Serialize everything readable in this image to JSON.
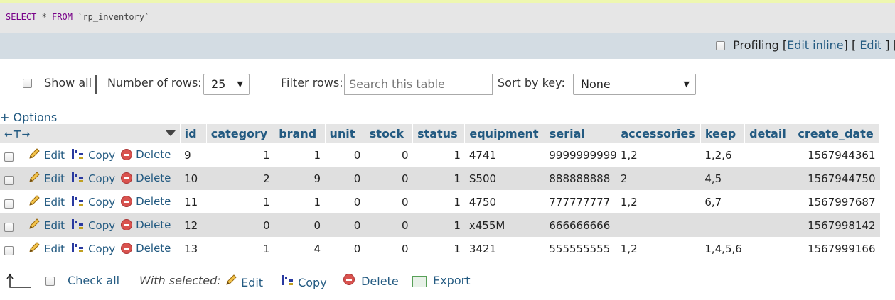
{
  "sql": {
    "kw_select": "SELECT",
    "rest_star": " * ",
    "kw_from": "FROM",
    "table": " `rp_inventory`"
  },
  "profiling": {
    "label": "Profiling",
    "edit_inline": "Edit inline",
    "edit": "Edit",
    "explain_cut": "E",
    "open": "[",
    "close": "]"
  },
  "nav": {
    "show_all": "Show all",
    "num_rows_label": "Number of rows:",
    "num_rows_value": "25",
    "filter_label": "Filter rows:",
    "filter_placeholder": "Search this table",
    "sort_label": "Sort by key:",
    "sort_value": "None"
  },
  "options": "+ Options",
  "columns": [
    "id",
    "category",
    "brand",
    "unit",
    "stock",
    "status",
    "equipment",
    "serial",
    "accessories",
    "keep",
    "detail",
    "create_date"
  ],
  "actions": {
    "edit": "Edit",
    "copy": "Copy",
    "delete": "Delete"
  },
  "rows": [
    {
      "id": "9",
      "category": "1",
      "brand": "1",
      "unit": "0",
      "stock": "0",
      "status": "1",
      "equipment": "4741",
      "serial": "9999999999",
      "accessories": "1,2",
      "keep": "1,2,6",
      "detail": "",
      "create_date": "1567944361"
    },
    {
      "id": "10",
      "category": "2",
      "brand": "9",
      "unit": "0",
      "stock": "0",
      "status": "1",
      "equipment": "S500",
      "serial": "888888888",
      "accessories": "2",
      "keep": "4,5",
      "detail": "",
      "create_date": "1567944750"
    },
    {
      "id": "11",
      "category": "1",
      "brand": "1",
      "unit": "0",
      "stock": "0",
      "status": "1",
      "equipment": "4750",
      "serial": "777777777",
      "accessories": "1,2",
      "keep": "6,7",
      "detail": "",
      "create_date": "1567997687"
    },
    {
      "id": "12",
      "category": "0",
      "brand": "0",
      "unit": "0",
      "stock": "0",
      "status": "1",
      "equipment": "x455M",
      "serial": "666666666",
      "accessories": "",
      "keep": "",
      "detail": "",
      "create_date": "1567998142"
    },
    {
      "id": "13",
      "category": "1",
      "brand": "4",
      "unit": "0",
      "stock": "0",
      "status": "1",
      "equipment": "3421",
      "serial": "555555555",
      "accessories": "1,2",
      "keep": "1,4,5,6",
      "detail": "",
      "create_date": "1567999166"
    }
  ],
  "footer": {
    "check_all": "Check all",
    "with_selected": "With selected:",
    "edit": "Edit",
    "copy": "Copy",
    "delete": "Delete",
    "export": "Export"
  },
  "icons": {
    "edit": "pencil-icon",
    "copy": "copy-row-icon",
    "delete": "delete-icon",
    "export": "export-icon",
    "check_all_arrow": "select-arrow-icon",
    "column_resize": "column-arrows-icon",
    "sort_menu": "dropdown-triangle-icon"
  },
  "colors": {
    "link": "#235a81",
    "header_bg": "#e5e5e5",
    "row_alt": "#dfdfdf",
    "profbar": "#d3dce3",
    "sqlbox": "#e6e6e6"
  }
}
